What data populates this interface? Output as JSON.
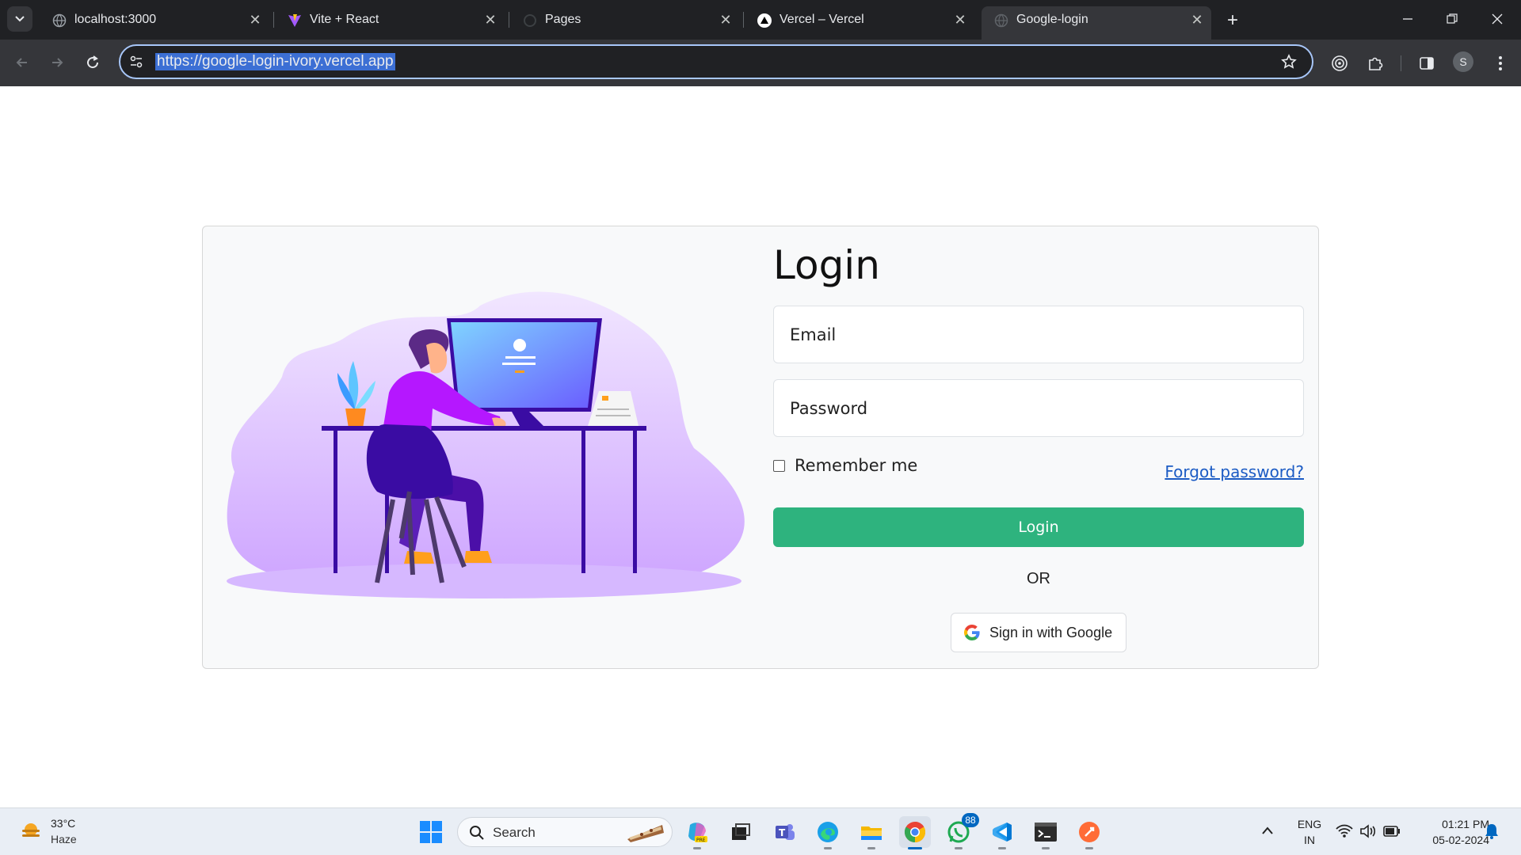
{
  "browser": {
    "tabs": [
      {
        "title": "localhost:3000",
        "icon": "globe-icon"
      },
      {
        "title": "Vite + React",
        "icon": "vite-icon"
      },
      {
        "title": "Pages",
        "icon": "github-icon"
      },
      {
        "title": "Vercel – Vercel",
        "icon": "vercel-icon"
      },
      {
        "title": "Google-login",
        "icon": "globe-icon",
        "active": true
      }
    ],
    "url": "https://google-login-ivory.vercel.app",
    "profile_initial": "S"
  },
  "page": {
    "title": "Login",
    "email_placeholder": "Email",
    "password_placeholder": "Password",
    "remember_label": "Remember me",
    "forgot_link": "Forgot password?",
    "login_button": "Login",
    "or_text": "OR",
    "google_button": "Sign in with Google",
    "accent_color": "#2eb37e"
  },
  "taskbar": {
    "weather_temp": "33°C",
    "weather_desc": "Haze",
    "search_label": "Search",
    "whatsapp_badge": "88",
    "language": "ENG",
    "region": "IN",
    "time": "01:21 PM",
    "date": "05-02-2024"
  }
}
